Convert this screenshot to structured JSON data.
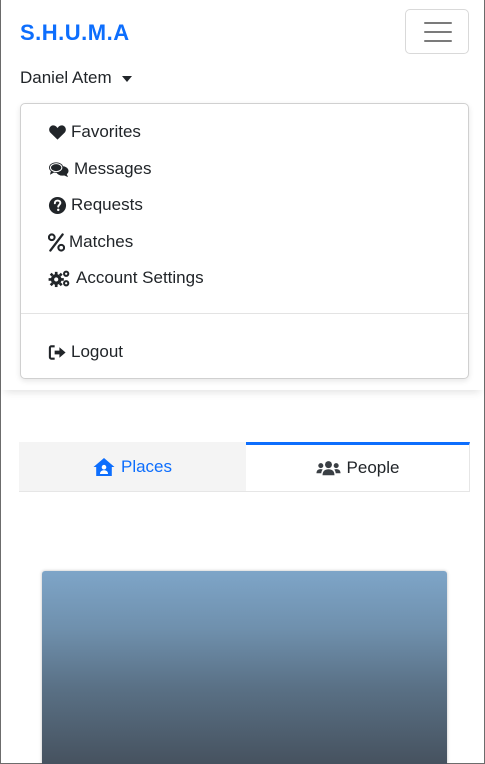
{
  "brand": {
    "name": "S.H.U.M.A"
  },
  "user_menu": {
    "username": "Daniel Atem",
    "items": [
      {
        "label": "Favorites",
        "icon": "heart-icon"
      },
      {
        "label": "Messages",
        "icon": "comments-icon"
      },
      {
        "label": "Requests",
        "icon": "question-circle-icon"
      },
      {
        "label": "Matches",
        "icon": "percent-icon"
      },
      {
        "label": "Account Settings",
        "icon": "cogs-icon"
      }
    ],
    "logout": {
      "label": "Logout",
      "icon": "sign-out-icon"
    }
  },
  "tabs": [
    {
      "label": "Places",
      "icon": "house-user-icon",
      "active": false
    },
    {
      "label": "People",
      "icon": "users-icon",
      "active": true
    }
  ],
  "colors": {
    "primary": "#0d6efd",
    "text": "#212529"
  }
}
